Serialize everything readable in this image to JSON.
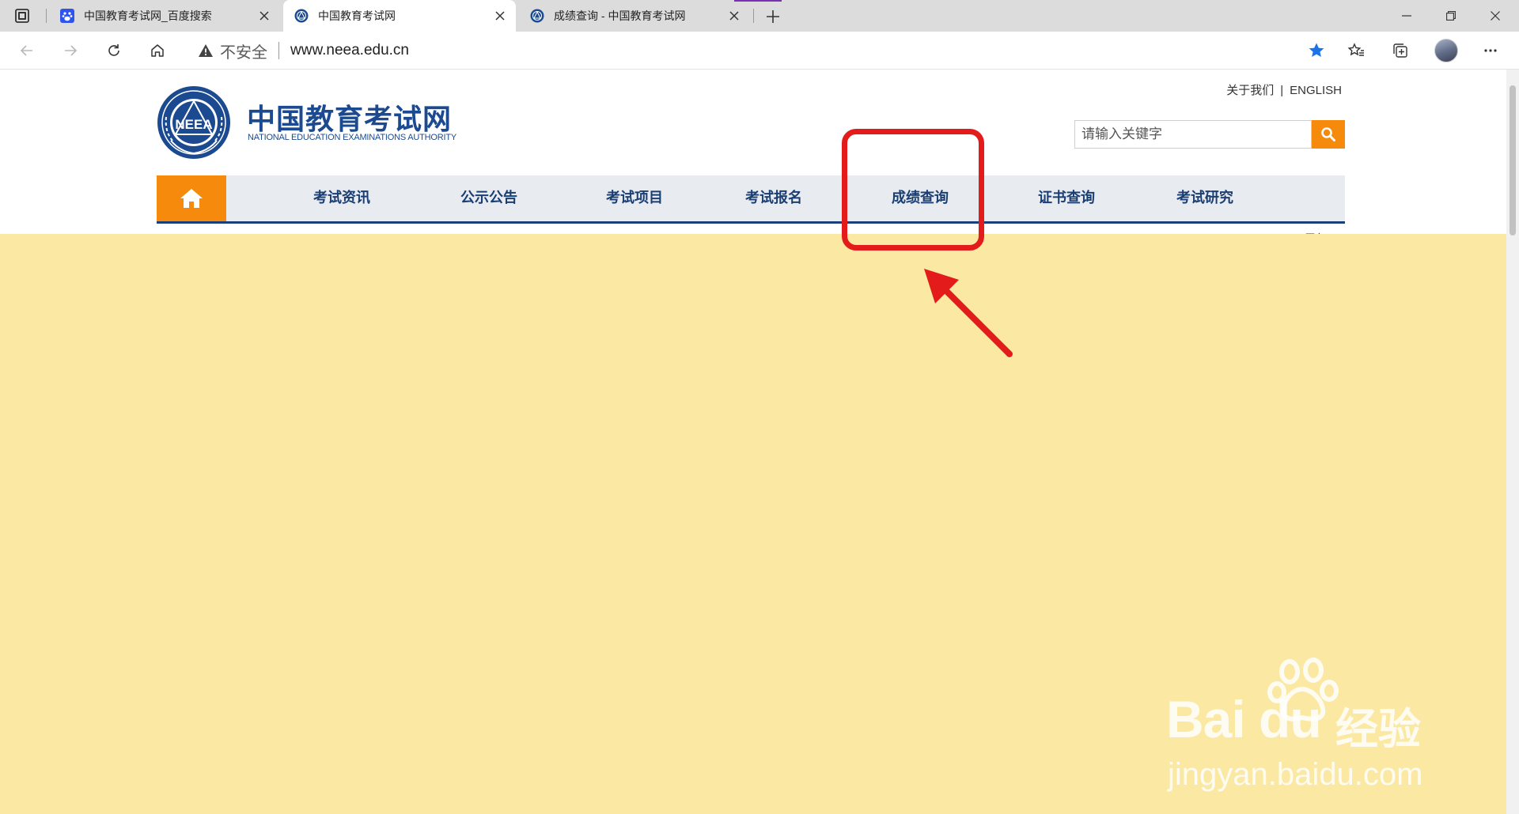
{
  "browser": {
    "tabs": [
      {
        "title": "中国教育考试网_百度搜索",
        "active": false,
        "favicon": "baidu-paw-icon"
      },
      {
        "title": "中国教育考试网",
        "active": true,
        "favicon": "neea-logo-icon"
      },
      {
        "title": "成绩查询 - 中国教育考试网",
        "active": false,
        "favicon": "neea-logo-icon"
      }
    ],
    "security_label": "不安全",
    "url": "www.neea.edu.cn",
    "accent_color": "#1a73e8"
  },
  "site": {
    "logo_cn": "中国教育考试网",
    "logo_en": "NATIONAL EDUCATION EXAMINATIONS AUTHORITY",
    "emblem_text": "NEEA",
    "top_links": {
      "about": "关于我们",
      "separator": "|",
      "english": "ENGLISH"
    },
    "search_placeholder": "请输入关键字",
    "nav": [
      "考试资讯",
      "公示公告",
      "考试项目",
      "考试报名",
      "成绩查询",
      "证书查询",
      "考试研究"
    ],
    "more_hint": "更多",
    "brand_color": "#1b4a90",
    "orange": "#f58a0c"
  },
  "annotation": {
    "highlight_target": "成绩查询",
    "box_color": "#e41b1b",
    "overlay_color": "#fbe8a3"
  },
  "watermark": {
    "brand": "Bai du",
    "product": "经验",
    "url": "jingyan.baidu.com"
  }
}
